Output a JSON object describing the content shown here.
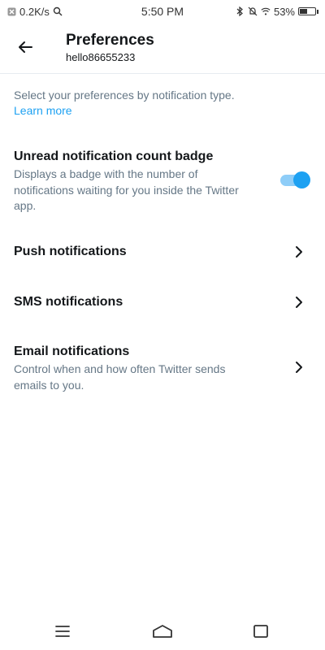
{
  "status_bar": {
    "network_speed": "0.2K/s",
    "time": "5:50 PM",
    "battery_percent": "53%",
    "battery_level": 0.53,
    "icons": [
      "notification-icon",
      "search-icon",
      "bluetooth-icon",
      "vibrate-icon",
      "wifi-icon",
      "battery-icon"
    ]
  },
  "header": {
    "title": "Preferences",
    "subtitle": "hello86655233",
    "back_icon": "back-arrow-icon"
  },
  "intro": {
    "text": "Select your preferences by notification type.",
    "link": "Learn more"
  },
  "settings": [
    {
      "title": "Unread notification count badge",
      "description": "Displays a badge with the number of notifications waiting for you inside the Twitter app.",
      "control": "toggle",
      "enabled": true
    },
    {
      "title": "Push notifications",
      "control": "chevron-right-icon"
    },
    {
      "title": "SMS notifications",
      "control": "chevron-right-icon"
    },
    {
      "title": "Email notifications",
      "description": "Control when and how often Twitter sends emails to you.",
      "control": "chevron-right-icon"
    }
  ],
  "nav_bar": {
    "icons": [
      "menu-icon",
      "home-icon",
      "back-square-icon"
    ]
  },
  "colors": {
    "accent": "#1da1f2",
    "toggle_track": "#8ecdf8",
    "text_primary": "#14171a",
    "text_secondary": "#657786"
  }
}
